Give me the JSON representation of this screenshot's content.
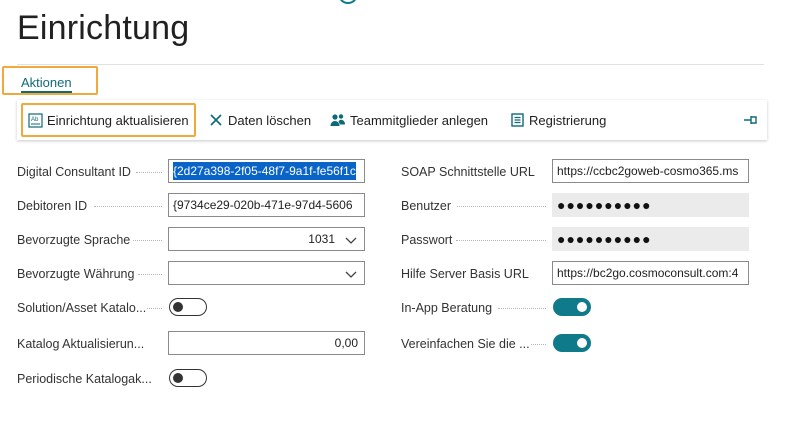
{
  "page": {
    "title": "Einrichtung"
  },
  "tabs": {
    "actions_label": "Aktionen"
  },
  "actions": [
    {
      "label": "Einrichtung aktualisieren",
      "icon": "refresh-setup-icon"
    },
    {
      "label": "Daten löschen",
      "icon": "delete-x-icon"
    },
    {
      "label": "Teammitglieder anlegen",
      "icon": "people-icon"
    },
    {
      "label": "Registrierung",
      "icon": "register-icon"
    }
  ],
  "pin_icon": "pin-icon",
  "left_fields": {
    "digital_consultant_id": {
      "label": "Digital Consultant ID",
      "value": "{2d27a398-2f05-48f7-9a1f-fe56f1c"
    },
    "debitoren_id": {
      "label": "Debitoren ID",
      "value": "{9734ce29-020b-471e-97d4-5606"
    },
    "bevorzugte_sprache": {
      "label": "Bevorzugte Sprache",
      "value": "1031"
    },
    "bevorzugte_waehrung": {
      "label": "Bevorzugte Währung",
      "value": ""
    },
    "solution_asset": {
      "label": "Solution/Asset Katalo...",
      "on": false
    },
    "katalog_aktualisierung": {
      "label": "Katalog Aktualisierun...",
      "value": "0,00"
    },
    "periodische": {
      "label": "Periodische Katalogak...",
      "on": false
    }
  },
  "right_fields": {
    "soap_url": {
      "label": "SOAP Schnittstelle URL",
      "value": "https://ccbc2goweb-cosmo365.ms"
    },
    "benutzer": {
      "label": "Benutzer",
      "value": "●●●●●●●●●●"
    },
    "passwort": {
      "label": "Passwort",
      "value": "●●●●●●●●●●"
    },
    "hilfe_url": {
      "label": "Hilfe Server Basis URL",
      "value": "https://bc2go.cosmoconsult.com:4"
    },
    "in_app": {
      "label": "In-App Beratung",
      "on": true
    },
    "vereinfachen": {
      "label": "Vereinfachen Sie die ...",
      "on": true
    }
  },
  "colors": {
    "accent": "#0f7b8a",
    "highlight": "#f2a93b",
    "selection": "#0a64c8"
  }
}
